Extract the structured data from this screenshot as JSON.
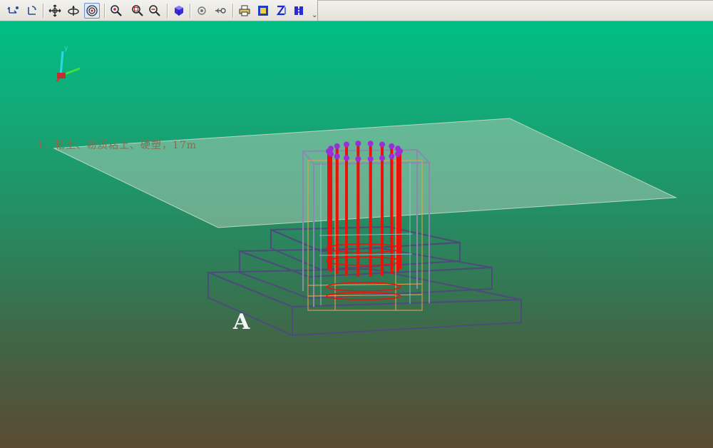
{
  "toolbar": {
    "buttons": [
      {
        "name": "move-axis-button",
        "icon": "axis-move-icon"
      },
      {
        "name": "rotate-axis-button",
        "icon": "axis-rotate-icon"
      },
      {
        "name": "pan-button",
        "icon": "pan-icon"
      },
      {
        "name": "orbit-button",
        "icon": "orbit-icon"
      },
      {
        "name": "target-view-button",
        "icon": "target-icon",
        "active": true
      },
      {
        "name": "zoom-in-button",
        "icon": "zoom-in-icon"
      },
      {
        "name": "zoom-window-button",
        "icon": "zoom-window-icon"
      },
      {
        "name": "zoom-out-button",
        "icon": "zoom-out-icon"
      },
      {
        "name": "shaded-view-button",
        "icon": "cube-icon"
      },
      {
        "name": "center-button",
        "icon": "circle-icon"
      },
      {
        "name": "pick-button",
        "icon": "pick-icon"
      },
      {
        "name": "print-button",
        "icon": "printer-icon"
      },
      {
        "name": "frame-view-button",
        "icon": "frame-icon"
      },
      {
        "name": "z-axis-button",
        "icon": "z-axis-icon"
      },
      {
        "name": "side-view-button",
        "icon": "side-view-icon"
      }
    ],
    "overflow_glyph": "⌄"
  },
  "viewport": {
    "layer_label": "1、粘土、粉质粘土、硬塑，17m",
    "marker_label": "A",
    "colors": {
      "gradient_top": "#00bf84",
      "gradient_bottom": "#5a4b33",
      "soil_plane": "#9bbfa8",
      "wireframe": "#4a4a78",
      "rebar": "#e8140c",
      "rebar_caps": "#9a2fd8",
      "pile_cage": "#e8a050"
    }
  }
}
